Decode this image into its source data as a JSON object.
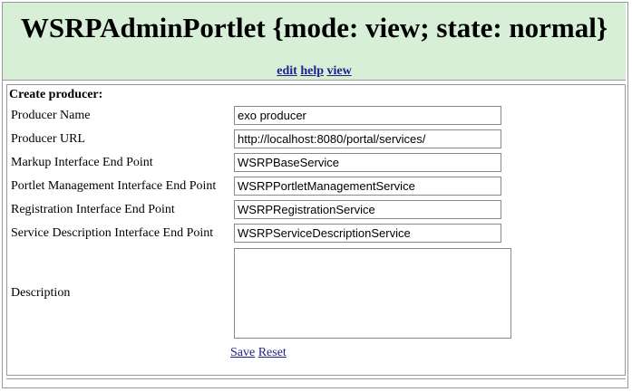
{
  "portlet": {
    "title": "WSRPAdminPortlet {mode: view; state: normal}",
    "modes": [
      "edit",
      "help",
      "view"
    ]
  },
  "form": {
    "section_title": "Create producer:",
    "fields": [
      {
        "label": "Producer Name",
        "value": "exo producer"
      },
      {
        "label": "Producer URL",
        "value": "http://localhost:8080/portal/services/"
      },
      {
        "label": "Markup Interface End Point",
        "value": "WSRPBaseService"
      },
      {
        "label": "Portlet Management Interface End Point",
        "value": "WSRPPortletManagementService"
      },
      {
        "label": "Registration Interface End Point",
        "value": "WSRPRegistrationService"
      },
      {
        "label": "Service Description Interface End Point",
        "value": "WSRPServiceDescriptionService"
      }
    ],
    "description_label": "Description",
    "description_value": "",
    "save_label": "Save",
    "reset_label": "Reset"
  },
  "colors": {
    "header_bg": "#d6efd6",
    "link": "#1f1f8a"
  }
}
